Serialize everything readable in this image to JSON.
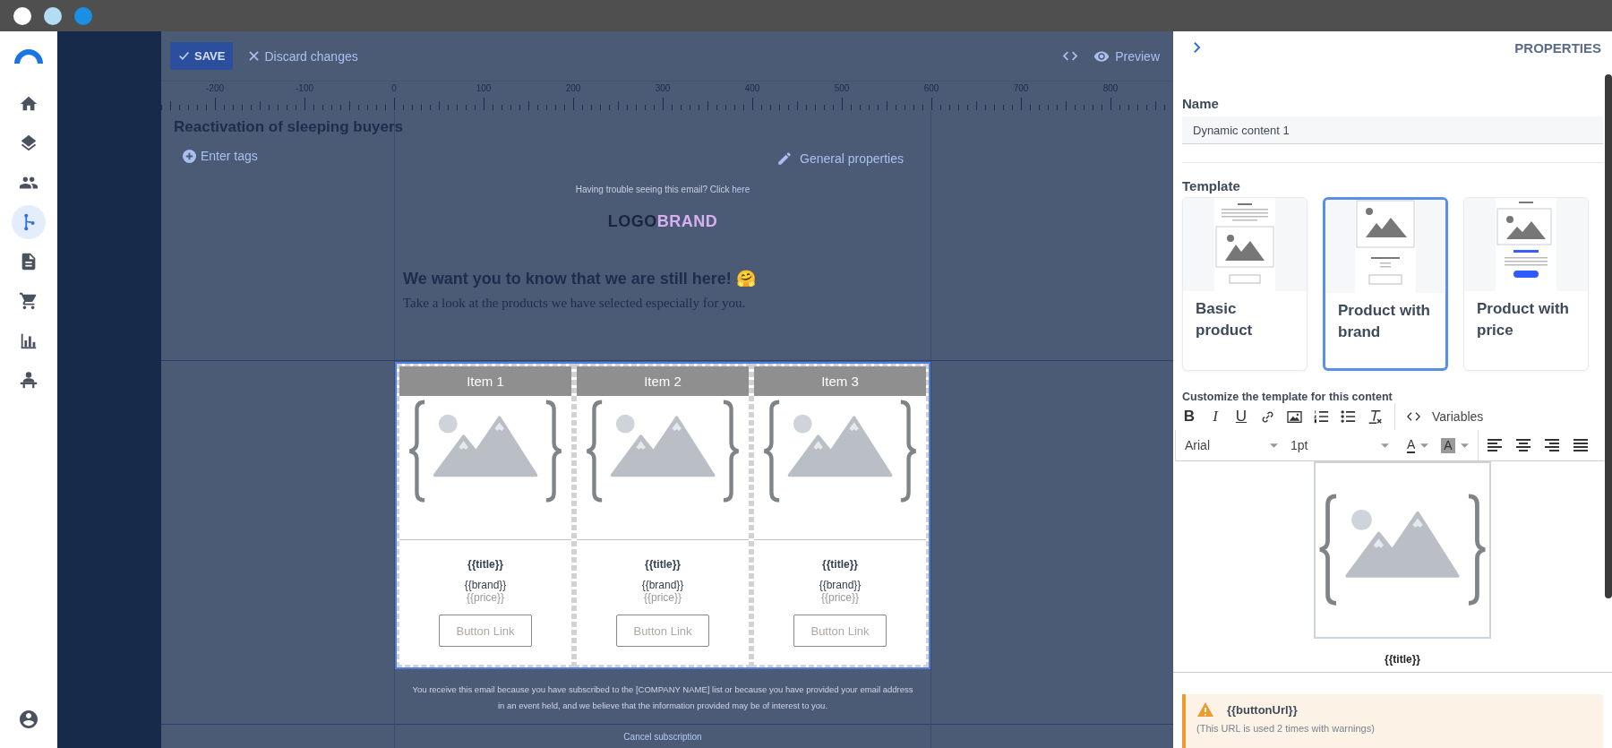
{
  "window_controls": [
    {
      "color": "#ffffff"
    },
    {
      "color": "#b3dcf5"
    },
    {
      "color": "#1a8fe3"
    }
  ],
  "nav": {
    "items": [
      {
        "kind": "home",
        "selected": false
      },
      {
        "kind": "layers",
        "selected": false
      },
      {
        "kind": "people",
        "selected": false
      },
      {
        "kind": "flow",
        "selected": true
      },
      {
        "kind": "document",
        "selected": false
      },
      {
        "kind": "cart",
        "selected": false
      },
      {
        "kind": "chart",
        "selected": false
      },
      {
        "kind": "org",
        "selected": false
      }
    ]
  },
  "toolbar": {
    "save": "SAVE",
    "discard": "Discard changes",
    "preview": "Preview"
  },
  "ruler": {
    "labels": [
      "-200",
      "-100",
      "0",
      "100",
      "200",
      "300",
      "400",
      "500",
      "600",
      "700",
      "800"
    ]
  },
  "campaign": {
    "title": "Reactivation of sleeping buyers",
    "tags": "Enter tags",
    "general_properties": "General properties"
  },
  "email": {
    "trouble_text": "Having trouble seeing this email? Click",
    "trouble_link": "here",
    "logo": [
      "LOGO",
      "BRAND"
    ],
    "heading": "We want you to know that we are still here! 🤗",
    "intro": "Take a look at the products we have selected especially for you."
  },
  "products": [
    {
      "header": "Item 1",
      "title": "{{title}}",
      "brand": "{{brand}}",
      "price": "{{price}}",
      "button": "Button Link"
    },
    {
      "header": "Item 2",
      "title": "{{title}}",
      "brand": "{{brand}}",
      "price": "{{price}}",
      "button": "Button Link"
    },
    {
      "header": "Item 3",
      "title": "{{title}}",
      "brand": "{{brand}}",
      "price": "{{price}}",
      "button": "Button Link"
    }
  ],
  "footer": {
    "text": "You receive this email because you have subscribed to the [COMPANY NAME] list or because you have provided your email address in an event held, and we believe that the information provided may be of interest to you.",
    "cancel": "Cancel subscription"
  },
  "panel": {
    "title": "PROPERTIES",
    "name_label": "Name",
    "name_value": "Dynamic content 1",
    "template_label": "Template",
    "templates": [
      {
        "kind": "basic",
        "label": "Basic product",
        "selected": false
      },
      {
        "kind": "brand",
        "label": "Product with brand",
        "selected": true
      },
      {
        "kind": "price",
        "label": "Product with price",
        "selected": false
      }
    ],
    "customize_label": "Customize the template for this content",
    "format_buttons": [
      "B",
      "I",
      "U"
    ],
    "variables": "Variables",
    "font": "Arial",
    "size": "1pt",
    "text_color": "A",
    "highlight": "A",
    "preview_title": "{{title}}",
    "warning": {
      "variable": "{{buttonUrl}}",
      "note": "(This URL is used 2 times with warnings)"
    }
  }
}
